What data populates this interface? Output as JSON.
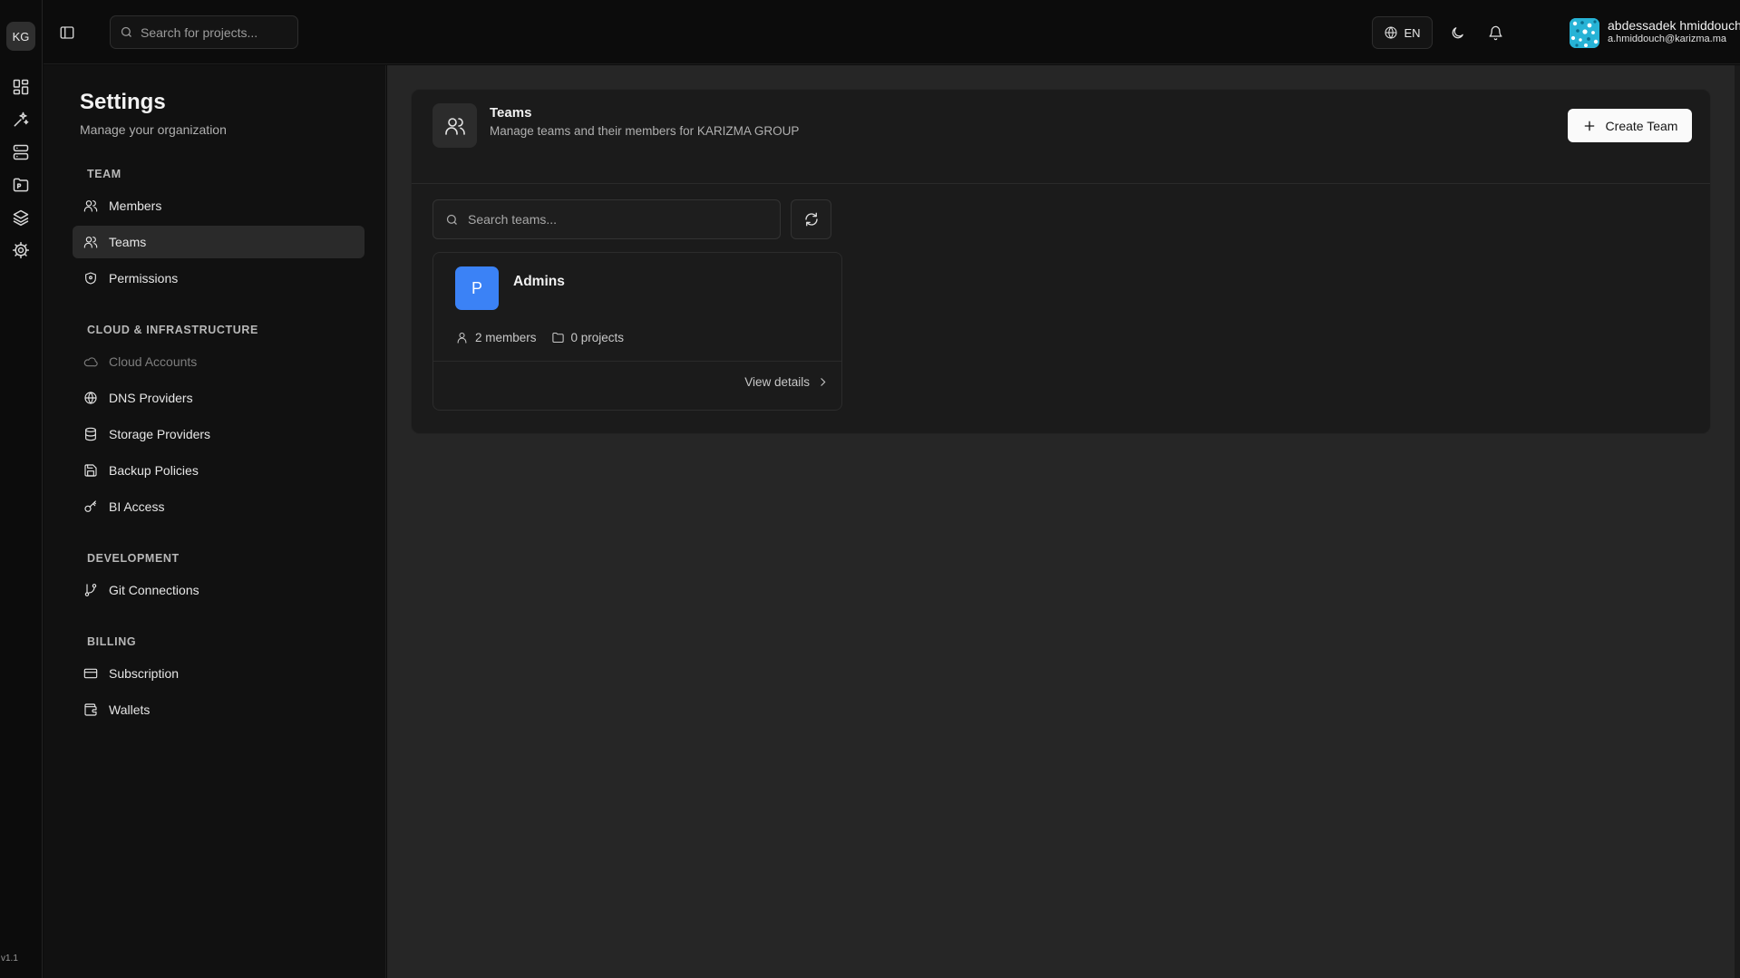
{
  "org": {
    "initials": "KG"
  },
  "version": "v1.1",
  "rail": {
    "icons": [
      "dashboard-icon",
      "sparkles-icon",
      "server-icon",
      "projects-folder-icon",
      "layers-icon",
      "settings-gear-icon"
    ]
  },
  "topbar": {
    "search_placeholder": "Search for projects...",
    "language": "EN",
    "user": {
      "name": "abdessadek hmiddouch",
      "email": "a.hmiddouch@karizma.ma"
    }
  },
  "settings": {
    "title": "Settings",
    "subtitle": "Manage your organization",
    "sections": {
      "team": {
        "label": "TEAM",
        "items": [
          {
            "label": "Members",
            "icon": "users-icon"
          },
          {
            "label": "Teams",
            "icon": "team-icon",
            "active": true
          },
          {
            "label": "Permissions",
            "icon": "shield-icon"
          }
        ]
      },
      "cloud": {
        "label": "CLOUD & INFRASTRUCTURE",
        "items": [
          {
            "label": "Cloud Accounts",
            "icon": "cloud-icon",
            "disabled": true
          },
          {
            "label": "DNS Providers",
            "icon": "globe-icon"
          },
          {
            "label": "Storage Providers",
            "icon": "database-icon"
          },
          {
            "label": "Backup Policies",
            "icon": "save-icon"
          },
          {
            "label": "BI Access",
            "icon": "key-icon"
          }
        ]
      },
      "development": {
        "label": "DEVELOPMENT",
        "items": [
          {
            "label": "Git Connections",
            "icon": "git-branch-icon"
          }
        ]
      },
      "billing": {
        "label": "BILLING",
        "items": [
          {
            "label": "Subscription",
            "icon": "credit-card-icon"
          },
          {
            "label": "Wallets",
            "icon": "wallet-icon"
          }
        ]
      }
    }
  },
  "teams_page": {
    "title": "Teams",
    "subtitle": "Manage teams and their members for KARIZMA GROUP",
    "create_label": "Create Team",
    "search_placeholder": "Search teams...",
    "teams": [
      {
        "initial": "P",
        "name": "Admins",
        "members": "2 members",
        "projects": "0 projects",
        "view_label": "View details"
      }
    ]
  },
  "colors": {
    "accent_blue": "#3b82f6",
    "background": "#0c0c0c",
    "main_background": "#262626",
    "panel": "#1b1b1b"
  }
}
